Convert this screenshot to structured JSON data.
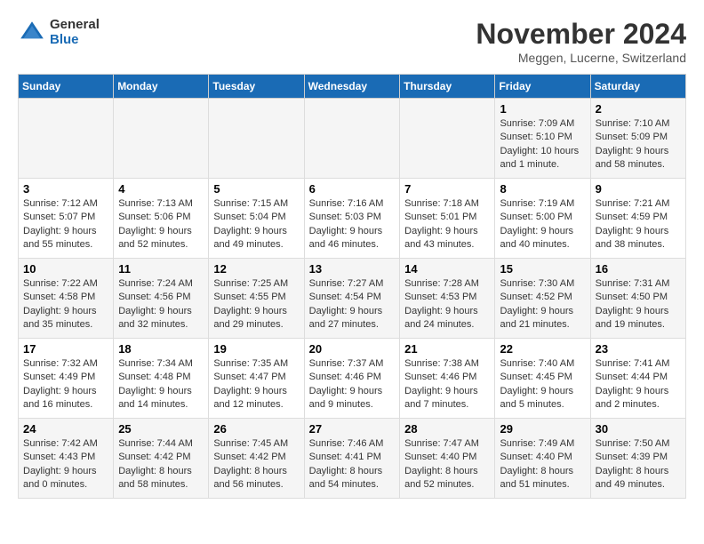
{
  "header": {
    "logo_general": "General",
    "logo_blue": "Blue",
    "month_title": "November 2024",
    "location": "Meggen, Lucerne, Switzerland"
  },
  "days_of_week": [
    "Sunday",
    "Monday",
    "Tuesday",
    "Wednesday",
    "Thursday",
    "Friday",
    "Saturday"
  ],
  "weeks": [
    [
      {
        "day": "",
        "info": ""
      },
      {
        "day": "",
        "info": ""
      },
      {
        "day": "",
        "info": ""
      },
      {
        "day": "",
        "info": ""
      },
      {
        "day": "",
        "info": ""
      },
      {
        "day": "1",
        "info": "Sunrise: 7:09 AM\nSunset: 5:10 PM\nDaylight: 10 hours and 1 minute."
      },
      {
        "day": "2",
        "info": "Sunrise: 7:10 AM\nSunset: 5:09 PM\nDaylight: 9 hours and 58 minutes."
      }
    ],
    [
      {
        "day": "3",
        "info": "Sunrise: 7:12 AM\nSunset: 5:07 PM\nDaylight: 9 hours and 55 minutes."
      },
      {
        "day": "4",
        "info": "Sunrise: 7:13 AM\nSunset: 5:06 PM\nDaylight: 9 hours and 52 minutes."
      },
      {
        "day": "5",
        "info": "Sunrise: 7:15 AM\nSunset: 5:04 PM\nDaylight: 9 hours and 49 minutes."
      },
      {
        "day": "6",
        "info": "Sunrise: 7:16 AM\nSunset: 5:03 PM\nDaylight: 9 hours and 46 minutes."
      },
      {
        "day": "7",
        "info": "Sunrise: 7:18 AM\nSunset: 5:01 PM\nDaylight: 9 hours and 43 minutes."
      },
      {
        "day": "8",
        "info": "Sunrise: 7:19 AM\nSunset: 5:00 PM\nDaylight: 9 hours and 40 minutes."
      },
      {
        "day": "9",
        "info": "Sunrise: 7:21 AM\nSunset: 4:59 PM\nDaylight: 9 hours and 38 minutes."
      }
    ],
    [
      {
        "day": "10",
        "info": "Sunrise: 7:22 AM\nSunset: 4:58 PM\nDaylight: 9 hours and 35 minutes."
      },
      {
        "day": "11",
        "info": "Sunrise: 7:24 AM\nSunset: 4:56 PM\nDaylight: 9 hours and 32 minutes."
      },
      {
        "day": "12",
        "info": "Sunrise: 7:25 AM\nSunset: 4:55 PM\nDaylight: 9 hours and 29 minutes."
      },
      {
        "day": "13",
        "info": "Sunrise: 7:27 AM\nSunset: 4:54 PM\nDaylight: 9 hours and 27 minutes."
      },
      {
        "day": "14",
        "info": "Sunrise: 7:28 AM\nSunset: 4:53 PM\nDaylight: 9 hours and 24 minutes."
      },
      {
        "day": "15",
        "info": "Sunrise: 7:30 AM\nSunset: 4:52 PM\nDaylight: 9 hours and 21 minutes."
      },
      {
        "day": "16",
        "info": "Sunrise: 7:31 AM\nSunset: 4:50 PM\nDaylight: 9 hours and 19 minutes."
      }
    ],
    [
      {
        "day": "17",
        "info": "Sunrise: 7:32 AM\nSunset: 4:49 PM\nDaylight: 9 hours and 16 minutes."
      },
      {
        "day": "18",
        "info": "Sunrise: 7:34 AM\nSunset: 4:48 PM\nDaylight: 9 hours and 14 minutes."
      },
      {
        "day": "19",
        "info": "Sunrise: 7:35 AM\nSunset: 4:47 PM\nDaylight: 9 hours and 12 minutes."
      },
      {
        "day": "20",
        "info": "Sunrise: 7:37 AM\nSunset: 4:46 PM\nDaylight: 9 hours and 9 minutes."
      },
      {
        "day": "21",
        "info": "Sunrise: 7:38 AM\nSunset: 4:46 PM\nDaylight: 9 hours and 7 minutes."
      },
      {
        "day": "22",
        "info": "Sunrise: 7:40 AM\nSunset: 4:45 PM\nDaylight: 9 hours and 5 minutes."
      },
      {
        "day": "23",
        "info": "Sunrise: 7:41 AM\nSunset: 4:44 PM\nDaylight: 9 hours and 2 minutes."
      }
    ],
    [
      {
        "day": "24",
        "info": "Sunrise: 7:42 AM\nSunset: 4:43 PM\nDaylight: 9 hours and 0 minutes."
      },
      {
        "day": "25",
        "info": "Sunrise: 7:44 AM\nSunset: 4:42 PM\nDaylight: 8 hours and 58 minutes."
      },
      {
        "day": "26",
        "info": "Sunrise: 7:45 AM\nSunset: 4:42 PM\nDaylight: 8 hours and 56 minutes."
      },
      {
        "day": "27",
        "info": "Sunrise: 7:46 AM\nSunset: 4:41 PM\nDaylight: 8 hours and 54 minutes."
      },
      {
        "day": "28",
        "info": "Sunrise: 7:47 AM\nSunset: 4:40 PM\nDaylight: 8 hours and 52 minutes."
      },
      {
        "day": "29",
        "info": "Sunrise: 7:49 AM\nSunset: 4:40 PM\nDaylight: 8 hours and 51 minutes."
      },
      {
        "day": "30",
        "info": "Sunrise: 7:50 AM\nSunset: 4:39 PM\nDaylight: 8 hours and 49 minutes."
      }
    ]
  ]
}
